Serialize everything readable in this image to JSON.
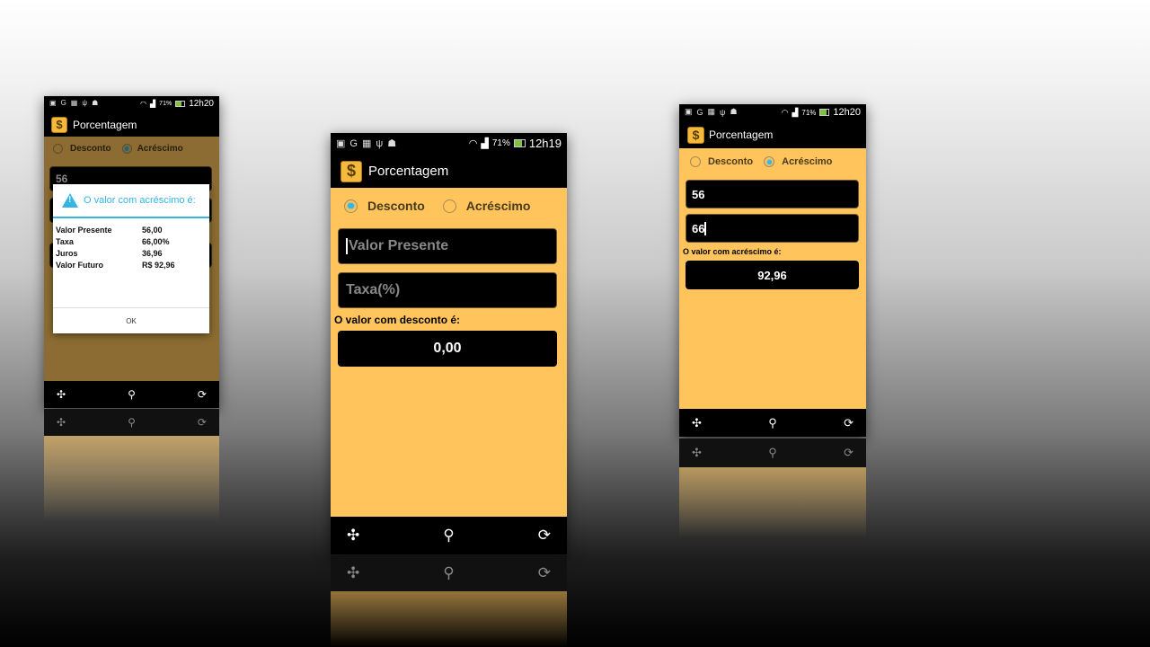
{
  "colors": {
    "app_bg": "#ffc55c",
    "accent": "#33b5e5",
    "bar": "#000000"
  },
  "app": {
    "title": "Porcentagem",
    "icon": "dollar-icon"
  },
  "left_phone": {
    "status": {
      "battery": "71%",
      "time": "12h20"
    },
    "radio": {
      "desconto": "Desconto",
      "acrescimo": "Acréscimo",
      "selected": "acrescimo"
    },
    "field1_value": "56",
    "dialog": {
      "title": "O valor com acréscimo é:",
      "rows": [
        {
          "label": "Valor Presente",
          "value": "56,00"
        },
        {
          "label": "Taxa",
          "value": "66,00%"
        },
        {
          "label": "Juros",
          "value": "36,96"
        },
        {
          "label": "Valor Futuro",
          "value": "R$ 92,96"
        }
      ],
      "ok": "OK"
    }
  },
  "center_phone": {
    "status": {
      "battery": "71%",
      "time": "12h19"
    },
    "radio": {
      "desconto": "Desconto",
      "acrescimo": "Acréscimo",
      "selected": "desconto"
    },
    "field1_placeholder": "Valor Presente",
    "field2_placeholder": "Taxa(%)",
    "result_label": "O valor com desconto é:",
    "result_value": "0,00"
  },
  "right_phone": {
    "status": {
      "battery": "71%",
      "time": "12h20"
    },
    "radio": {
      "desconto": "Desconto",
      "acrescimo": "Acréscimo",
      "selected": "acrescimo"
    },
    "field1_value": "56",
    "field2_value": "66",
    "result_label": "O valor com acréscimo é:",
    "result_value": "92,96"
  },
  "bottom_icons": [
    "network-icon",
    "search-icon",
    "refresh-icon"
  ]
}
